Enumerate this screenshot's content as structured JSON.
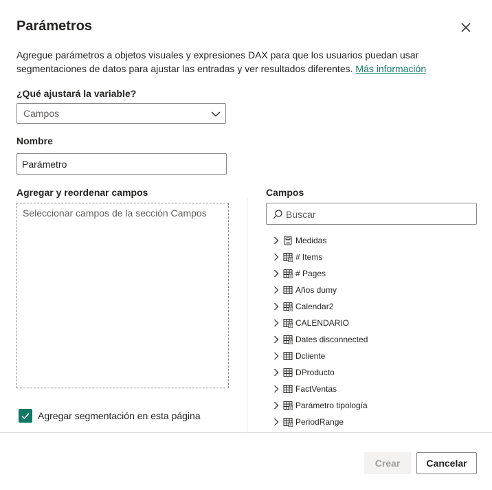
{
  "dialog": {
    "title": "Parámetros",
    "description": "Agregue parámetros a objetos visuales y expresiones DAX para que los usuarios puedan usar segmentaciones de datos para ajustar las entradas y ver resultados diferentes.",
    "learn_more_link": "Más información",
    "close_icon": "close-icon"
  },
  "variable": {
    "label": "¿Qué ajustará la variable?",
    "selected": "Campos"
  },
  "name": {
    "label": "Nombre",
    "value": "Parámetro"
  },
  "reorder": {
    "label": "Agregar y reordenar campos",
    "hint": "Seleccionar campos de la sección Campos"
  },
  "slicer_checkbox": {
    "label": "Agregar segmentación en esta página",
    "checked": true
  },
  "fields": {
    "label": "Campos",
    "search_placeholder": "Buscar",
    "items": [
      {
        "label": "Medidas",
        "icon": "measure-table-icon"
      },
      {
        "label": "# Items",
        "icon": "calculated-table-icon"
      },
      {
        "label": "# Pages",
        "icon": "calculated-table-icon"
      },
      {
        "label": "Años dumy",
        "icon": "table-icon"
      },
      {
        "label": "Calendar2",
        "icon": "calculated-table-icon"
      },
      {
        "label": "CALENDARIO",
        "icon": "calculated-table-icon"
      },
      {
        "label": "Dates disconnected",
        "icon": "calculated-table-icon"
      },
      {
        "label": "Dcliente",
        "icon": "table-icon"
      },
      {
        "label": "DProducto",
        "icon": "table-icon"
      },
      {
        "label": "FactVentas",
        "icon": "table-icon"
      },
      {
        "label": "Parámetro tipología",
        "icon": "calculated-table-icon"
      },
      {
        "label": "PeriodRange",
        "icon": "calculated-table-icon"
      }
    ]
  },
  "buttons": {
    "create": "Crear",
    "cancel": "Cancelar"
  },
  "colors": {
    "accent": "#117865",
    "text": "#252423",
    "border": "#8a8886",
    "disabled_bg": "#f3f2f1"
  }
}
